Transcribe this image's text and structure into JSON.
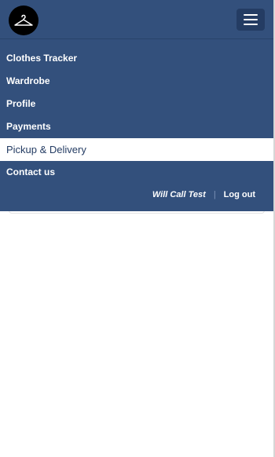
{
  "brand": {
    "logo_icon": "clothes-hanger-icon"
  },
  "navbar": {
    "toggle_icon": "hamburger-menu-icon",
    "background": "#33507c",
    "active_text_color": "#243c63"
  },
  "menu": {
    "items": [
      {
        "label": "Clothes Tracker"
      },
      {
        "label": "Wardrobe"
      },
      {
        "label": "Profile"
      },
      {
        "label": "Payments"
      },
      {
        "label": "Pickup & Delivery",
        "active": true
      },
      {
        "label": "Contact us"
      }
    ]
  },
  "user": {
    "name": "Will Call Test",
    "separator": "|",
    "logout_label": "Log out"
  }
}
